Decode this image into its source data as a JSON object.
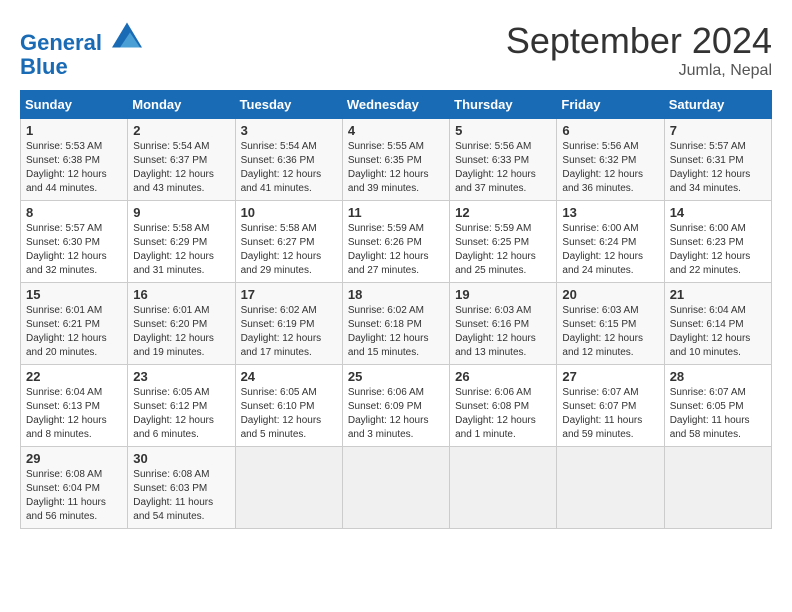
{
  "header": {
    "logo_line1": "General",
    "logo_line2": "Blue",
    "month_title": "September 2024",
    "subtitle": "Jumla, Nepal"
  },
  "weekdays": [
    "Sunday",
    "Monday",
    "Tuesday",
    "Wednesday",
    "Thursday",
    "Friday",
    "Saturday"
  ],
  "weeks": [
    [
      {
        "day": "1",
        "sunrise": "5:53 AM",
        "sunset": "6:38 PM",
        "daylight": "12 hours and 44 minutes."
      },
      {
        "day": "2",
        "sunrise": "5:54 AM",
        "sunset": "6:37 PM",
        "daylight": "12 hours and 43 minutes."
      },
      {
        "day": "3",
        "sunrise": "5:54 AM",
        "sunset": "6:36 PM",
        "daylight": "12 hours and 41 minutes."
      },
      {
        "day": "4",
        "sunrise": "5:55 AM",
        "sunset": "6:35 PM",
        "daylight": "12 hours and 39 minutes."
      },
      {
        "day": "5",
        "sunrise": "5:56 AM",
        "sunset": "6:33 PM",
        "daylight": "12 hours and 37 minutes."
      },
      {
        "day": "6",
        "sunrise": "5:56 AM",
        "sunset": "6:32 PM",
        "daylight": "12 hours and 36 minutes."
      },
      {
        "day": "7",
        "sunrise": "5:57 AM",
        "sunset": "6:31 PM",
        "daylight": "12 hours and 34 minutes."
      }
    ],
    [
      {
        "day": "8",
        "sunrise": "5:57 AM",
        "sunset": "6:30 PM",
        "daylight": "12 hours and 32 minutes."
      },
      {
        "day": "9",
        "sunrise": "5:58 AM",
        "sunset": "6:29 PM",
        "daylight": "12 hours and 31 minutes."
      },
      {
        "day": "10",
        "sunrise": "5:58 AM",
        "sunset": "6:27 PM",
        "daylight": "12 hours and 29 minutes."
      },
      {
        "day": "11",
        "sunrise": "5:59 AM",
        "sunset": "6:26 PM",
        "daylight": "12 hours and 27 minutes."
      },
      {
        "day": "12",
        "sunrise": "5:59 AM",
        "sunset": "6:25 PM",
        "daylight": "12 hours and 25 minutes."
      },
      {
        "day": "13",
        "sunrise": "6:00 AM",
        "sunset": "6:24 PM",
        "daylight": "12 hours and 24 minutes."
      },
      {
        "day": "14",
        "sunrise": "6:00 AM",
        "sunset": "6:23 PM",
        "daylight": "12 hours and 22 minutes."
      }
    ],
    [
      {
        "day": "15",
        "sunrise": "6:01 AM",
        "sunset": "6:21 PM",
        "daylight": "12 hours and 20 minutes."
      },
      {
        "day": "16",
        "sunrise": "6:01 AM",
        "sunset": "6:20 PM",
        "daylight": "12 hours and 19 minutes."
      },
      {
        "day": "17",
        "sunrise": "6:02 AM",
        "sunset": "6:19 PM",
        "daylight": "12 hours and 17 minutes."
      },
      {
        "day": "18",
        "sunrise": "6:02 AM",
        "sunset": "6:18 PM",
        "daylight": "12 hours and 15 minutes."
      },
      {
        "day": "19",
        "sunrise": "6:03 AM",
        "sunset": "6:16 PM",
        "daylight": "12 hours and 13 minutes."
      },
      {
        "day": "20",
        "sunrise": "6:03 AM",
        "sunset": "6:15 PM",
        "daylight": "12 hours and 12 minutes."
      },
      {
        "day": "21",
        "sunrise": "6:04 AM",
        "sunset": "6:14 PM",
        "daylight": "12 hours and 10 minutes."
      }
    ],
    [
      {
        "day": "22",
        "sunrise": "6:04 AM",
        "sunset": "6:13 PM",
        "daylight": "12 hours and 8 minutes."
      },
      {
        "day": "23",
        "sunrise": "6:05 AM",
        "sunset": "6:12 PM",
        "daylight": "12 hours and 6 minutes."
      },
      {
        "day": "24",
        "sunrise": "6:05 AM",
        "sunset": "6:10 PM",
        "daylight": "12 hours and 5 minutes."
      },
      {
        "day": "25",
        "sunrise": "6:06 AM",
        "sunset": "6:09 PM",
        "daylight": "12 hours and 3 minutes."
      },
      {
        "day": "26",
        "sunrise": "6:06 AM",
        "sunset": "6:08 PM",
        "daylight": "12 hours and 1 minute."
      },
      {
        "day": "27",
        "sunrise": "6:07 AM",
        "sunset": "6:07 PM",
        "daylight": "11 hours and 59 minutes."
      },
      {
        "day": "28",
        "sunrise": "6:07 AM",
        "sunset": "6:05 PM",
        "daylight": "11 hours and 58 minutes."
      }
    ],
    [
      {
        "day": "29",
        "sunrise": "6:08 AM",
        "sunset": "6:04 PM",
        "daylight": "11 hours and 56 minutes."
      },
      {
        "day": "30",
        "sunrise": "6:08 AM",
        "sunset": "6:03 PM",
        "daylight": "11 hours and 54 minutes."
      },
      {
        "day": "",
        "sunrise": "",
        "sunset": "",
        "daylight": ""
      },
      {
        "day": "",
        "sunrise": "",
        "sunset": "",
        "daylight": ""
      },
      {
        "day": "",
        "sunrise": "",
        "sunset": "",
        "daylight": ""
      },
      {
        "day": "",
        "sunrise": "",
        "sunset": "",
        "daylight": ""
      },
      {
        "day": "",
        "sunrise": "",
        "sunset": "",
        "daylight": ""
      }
    ]
  ]
}
